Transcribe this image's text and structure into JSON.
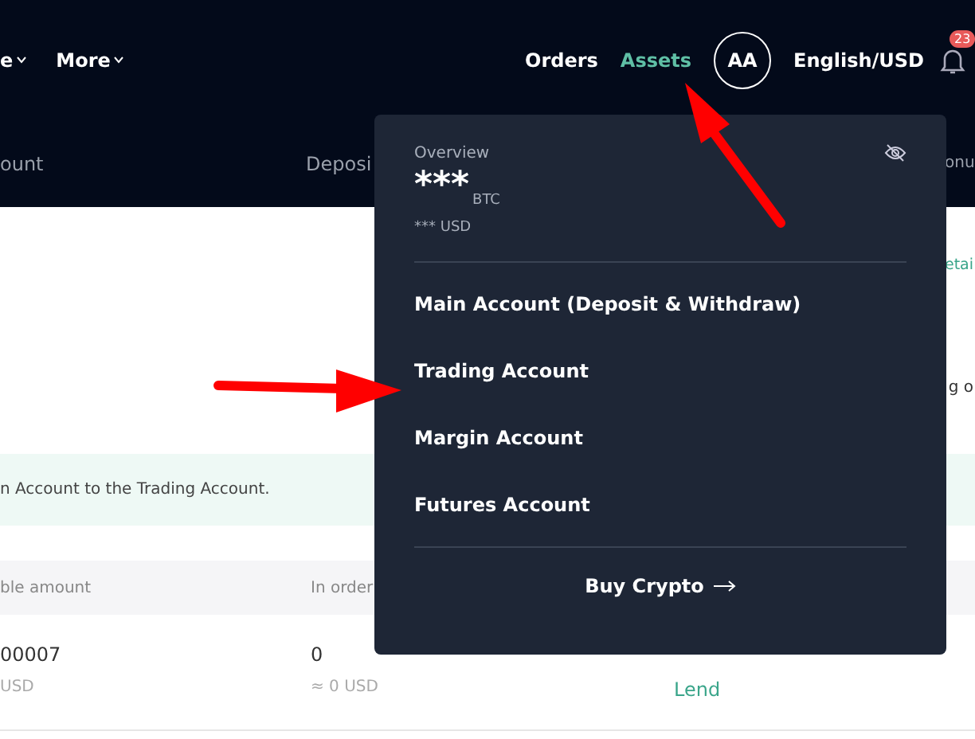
{
  "nav": {
    "menus": [
      {
        "label": "e"
      },
      {
        "label": "More"
      }
    ],
    "links": [
      {
        "label": "Orders",
        "selected": false
      },
      {
        "label": "Assets",
        "selected": true
      }
    ],
    "avatar": "AA",
    "language": "English/USD",
    "notifications": "23"
  },
  "subnav": [
    "ount",
    "Deposi",
    "onu"
  ],
  "content": {
    "details_link": "etai",
    "side_text": "g o",
    "banner": "n Account to the Trading Account.",
    "columns": [
      "ble amount",
      "In order"
    ],
    "row": {
      "amount": "00007",
      "amount_usd": "USD",
      "in_orders": "0",
      "in_orders_usd": "≈ 0 USD",
      "actions": [
        "Lend"
      ]
    }
  },
  "dropdown": {
    "overview_label": "Overview",
    "balance": "***",
    "currency": "BTC",
    "balance_usd": "*** USD",
    "items": [
      {
        "label": "Main Account (Deposit & Withdraw)"
      },
      {
        "label": "Trading Account"
      },
      {
        "label": "Margin Account"
      },
      {
        "label": "Futures Account"
      }
    ],
    "buy": "Buy Crypto"
  }
}
